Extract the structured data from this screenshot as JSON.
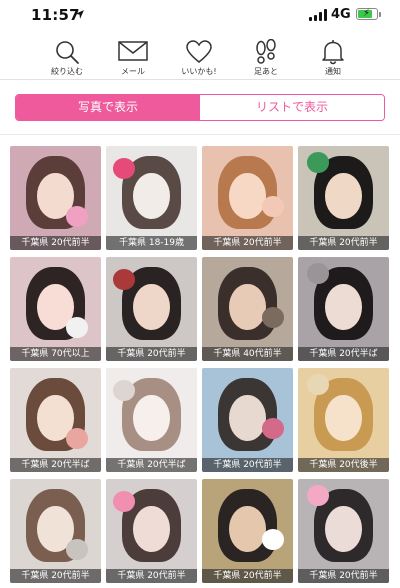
{
  "status_bar": {
    "time": "11:57",
    "network": "4G",
    "battery_level": 0.85,
    "battery_color": "#3cc84a"
  },
  "nav": {
    "items": [
      {
        "label": "絞り込む",
        "icon": "search-icon"
      },
      {
        "label": "メール",
        "icon": "mail-icon"
      },
      {
        "label": "いいかも!",
        "icon": "heart-icon"
      },
      {
        "label": "足あと",
        "icon": "footprints-icon"
      },
      {
        "label": "通知",
        "icon": "bell-icon"
      }
    ]
  },
  "view_toggle": {
    "photo_label": "写真で表示",
    "list_label": "リストで表示",
    "selected": "photo",
    "accent_color": "#ee5a9c"
  },
  "profiles": [
    {
      "caption": "千葉県 20代前半",
      "bg": "#cfa9b4",
      "hair": "#5b3d3a",
      "face": "#f3dccf",
      "accent": "#f0a0c0"
    },
    {
      "caption": "千葉県 18-19歳",
      "bg": "#e9e6e6",
      "hair": "#5a4a45",
      "face": "#f1ece8",
      "accent": "#e64a78"
    },
    {
      "caption": "千葉県 20代前半",
      "bg": "#e8c2ae",
      "hair": "#b8794e",
      "face": "#f6d8c4",
      "accent": "#f2c9b6"
    },
    {
      "caption": "千葉県 20代前半",
      "bg": "#c9c3b8",
      "hair": "#1d1a1a",
      "face": "#efd9c6",
      "accent": "#3b9a5a"
    },
    {
      "caption": "千葉県 70代以上",
      "bg": "#dcc4c8",
      "hair": "#2e2424",
      "face": "#f7ddd6",
      "accent": "#f1f1f1"
    },
    {
      "caption": "千葉県 20代前半",
      "bg": "#cdc8c6",
      "hair": "#2a2323",
      "face": "#eed7c8",
      "accent": "#aa3a3a"
    },
    {
      "caption": "千葉県 40代前半",
      "bg": "#b7a89c",
      "hair": "#3a2f2b",
      "face": "#e8cbb6",
      "accent": "#7b6a5e"
    },
    {
      "caption": "千葉県 20代半ば",
      "bg": "#a9a2a6",
      "hair": "#1f1a1c",
      "face": "#eddcd4",
      "accent": "#9a9497"
    },
    {
      "caption": "千葉県 20代半ば",
      "bg": "#e2dad6",
      "hair": "#6a4b3c",
      "face": "#f4dfd3",
      "accent": "#e9a5a0"
    },
    {
      "caption": "千葉県 20代半ば",
      "bg": "#efeceb",
      "hair": "#a88f84",
      "face": "#f6efec",
      "accent": "#dcd5d2"
    },
    {
      "caption": "千葉県 20代前半",
      "bg": "#a8c3d8",
      "hair": "#3b3633",
      "face": "#e8d9d0",
      "accent": "#d46a8a"
    },
    {
      "caption": "千葉県 20代後半",
      "bg": "#e7cfa2",
      "hair": "#c99a52",
      "face": "#f6e2cb",
      "accent": "#e8d7b4"
    },
    {
      "caption": "千葉県 20代前半",
      "bg": "#dcd6d2",
      "hair": "#7a5e50",
      "face": "#f1e2d8",
      "accent": "#c9c3bf"
    },
    {
      "caption": "千葉県 20代前半",
      "bg": "#d6cfd0",
      "hair": "#4c3d3a",
      "face": "#efdcd6",
      "accent": "#f08fb0"
    },
    {
      "caption": "千葉県 20代前半",
      "bg": "#b9a47a",
      "hair": "#2a2523",
      "face": "#e5c7ae",
      "accent": "#ffffff"
    },
    {
      "caption": "千葉県 20代前半",
      "bg": "#b8b4b6",
      "hair": "#2e2a2c",
      "face": "#ecdcd8",
      "accent": "#f3a8c4"
    }
  ]
}
